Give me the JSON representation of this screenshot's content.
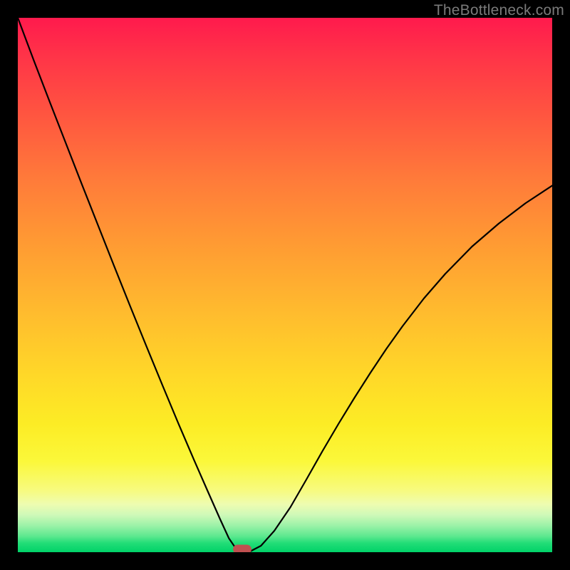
{
  "watermark": "TheBottleneck.com",
  "chart_data": {
    "type": "line",
    "title": "",
    "xlabel": "",
    "ylabel": "",
    "xlim": [
      0,
      100
    ],
    "ylim": [
      0,
      100
    ],
    "series": [
      {
        "name": "bottleneck-curve",
        "x": [
          0,
          3,
          6,
          9,
          12,
          15,
          18,
          21,
          24,
          27,
          30,
          33,
          35.5,
          37.8,
          39.5,
          40.8,
          41.8,
          43.2,
          45.5,
          48,
          51,
          54,
          57,
          60,
          63,
          66,
          69,
          72,
          76,
          80,
          85,
          90,
          95,
          100
        ],
        "y": [
          100,
          92,
          84.2,
          76.5,
          68.8,
          61.2,
          53.6,
          46.1,
          38.7,
          31.4,
          24.2,
          17.2,
          11.5,
          6.3,
          2.6,
          0.7,
          0,
          0,
          1.2,
          4.0,
          8.4,
          13.6,
          18.9,
          24.0,
          28.9,
          33.6,
          38.1,
          42.3,
          47.5,
          52.1,
          57.2,
          61.5,
          65.3,
          68.6
        ]
      }
    ],
    "flat_bottom_x": [
      40.8,
      43.2
    ],
    "marker": {
      "x": 42.0,
      "y": 0.5
    },
    "background_gradient": {
      "top": "#ff1a4d",
      "mid_upper": "#ff9a33",
      "mid": "#ffd828",
      "mid_lower": "#f7fb80",
      "bottom": "#00d268"
    }
  },
  "semantics": {
    "curve_name": "bottleneck-curve",
    "marker_name": "optimal-point-marker"
  }
}
